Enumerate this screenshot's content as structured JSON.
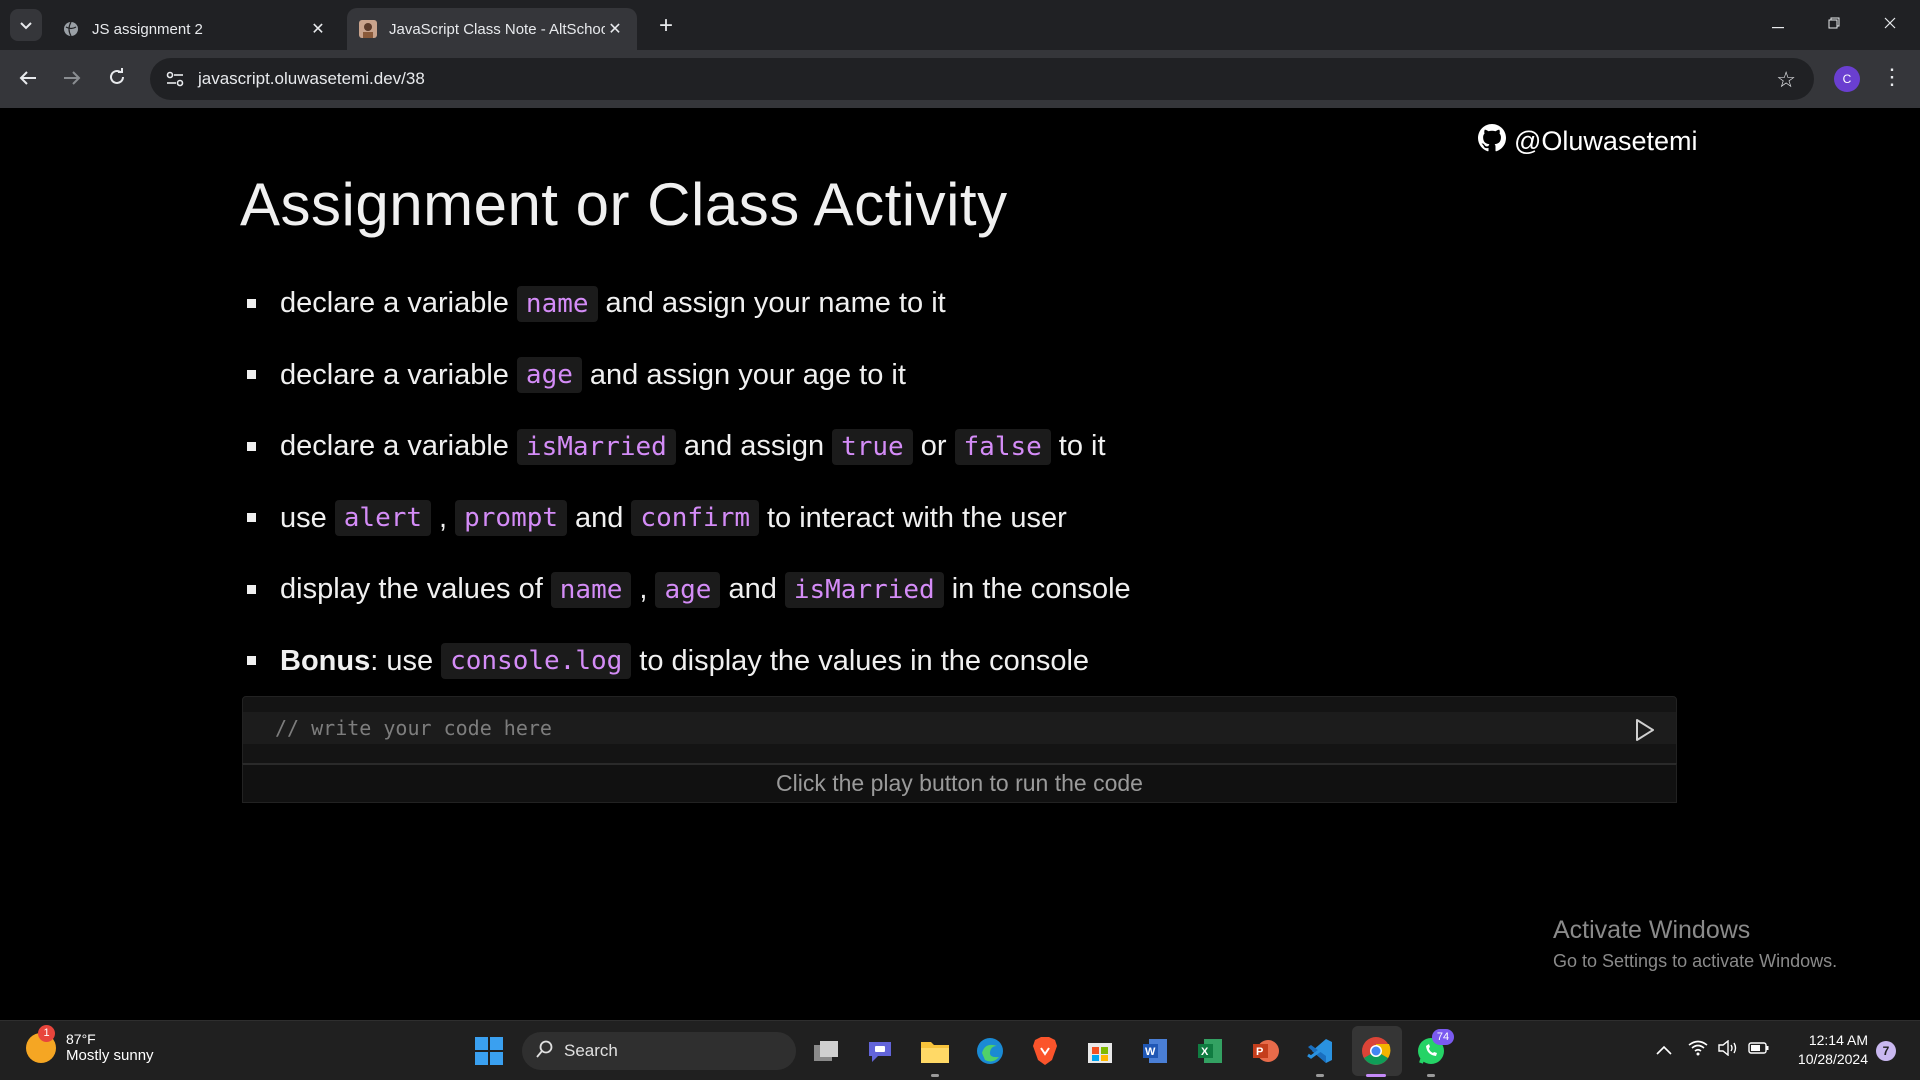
{
  "browser": {
    "tabs": [
      {
        "title": "JS assignment 2",
        "active": false
      },
      {
        "title": "JavaScript Class Note - AltSchool",
        "active": true
      }
    ],
    "new_tab_symbol": "+",
    "url": "javascript.oluwasetemi.dev/38",
    "profile_initial": "C"
  },
  "page": {
    "github_handle": "@Oluwasetemi",
    "heading": "Assignment or Class Activity",
    "bullets": {
      "b1": {
        "t1": "declare a variable",
        "c1": "name",
        "t2": "and assign your name to it"
      },
      "b2": {
        "t1": "declare a variable",
        "c1": "age",
        "t2": "and assign your age to it"
      },
      "b3": {
        "t1": "declare a variable",
        "c1": "isMarried",
        "t2": "and assign",
        "c2": "true",
        "t3": "or",
        "c3": "false",
        "t4": "to it"
      },
      "b4": {
        "t1": "use",
        "c1": "alert",
        "t2": ",",
        "c2": "prompt",
        "t3": "and",
        "c3": "confirm",
        "t4": "to interact with the user"
      },
      "b5": {
        "t1": "display the values of",
        "c1": "name",
        "t2": ",",
        "c2": "age",
        "t3": "and",
        "c3": "isMarried",
        "t4": "in the console"
      },
      "b6": {
        "bold": "Bonus",
        "t1": ": use",
        "c1": "console.log",
        "t2": "to display the values in the console"
      }
    },
    "editor": {
      "placeholder": "// write your code here",
      "result_hint": "Click the play button to run the code"
    },
    "watermark": {
      "title": "Activate Windows",
      "subtitle": "Go to Settings to activate Windows."
    }
  },
  "taskbar": {
    "weather": {
      "temp": "87°F",
      "condition": "Mostly sunny",
      "badge": "1"
    },
    "search_label": "Search",
    "whatsapp_badge": "74",
    "time": "12:14 AM",
    "date": "10/28/2024",
    "notifications": "7"
  },
  "colors": {
    "code_text": "#d48cf7",
    "code_bg": "#1b1b1b",
    "page_bg": "#000000",
    "chrome_bg": "#202124",
    "toolbar_bg": "#35363a"
  }
}
